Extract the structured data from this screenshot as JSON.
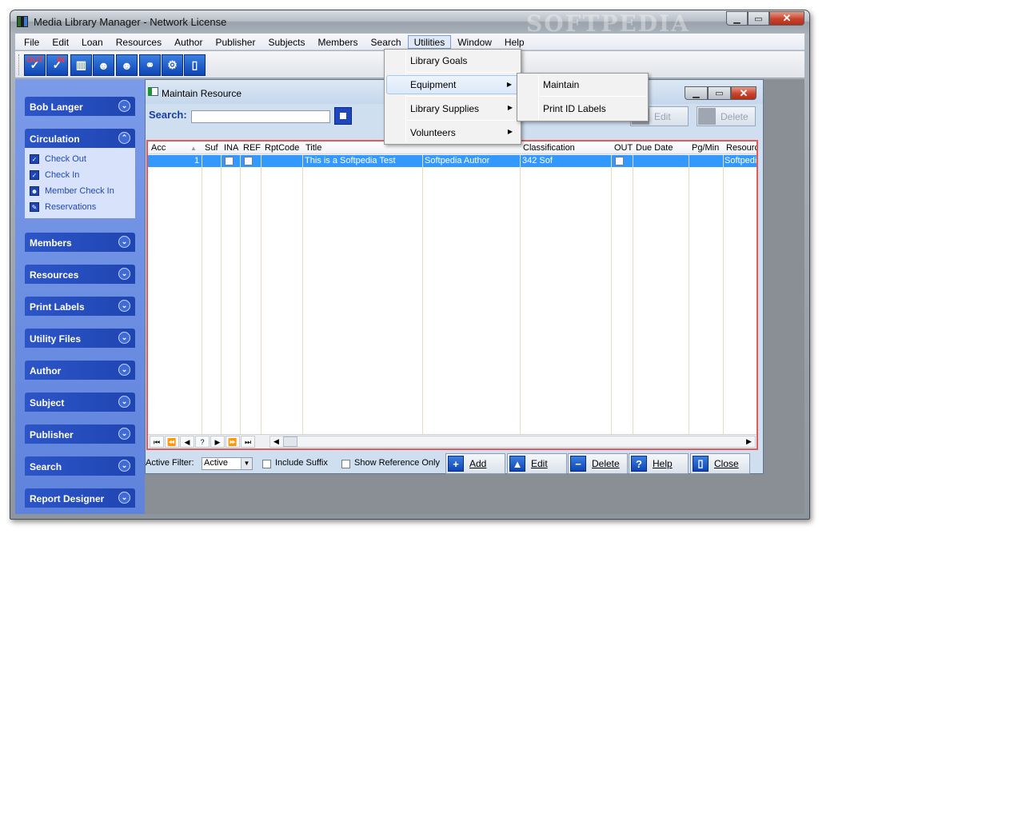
{
  "window": {
    "title": "Media Library Manager - Network License",
    "watermark": "SOFTPEDIA"
  },
  "menubar": [
    "File",
    "Edit",
    "Loan",
    "Resources",
    "Author",
    "Publisher",
    "Subjects",
    "Members",
    "Search",
    "Utilities",
    "Window",
    "Help"
  ],
  "toolbar": {
    "checkout_tag": "OUT",
    "checkin_tag": "IN"
  },
  "sidebar": {
    "user": "Bob Langer",
    "circulation": {
      "title": "Circulation",
      "items": [
        "Check Out",
        "Check In",
        "Member Check In",
        "Reservations"
      ]
    },
    "groups": [
      "Members",
      "Resources",
      "Print Labels",
      "Utility Files",
      "Author",
      "Subject",
      "Publisher",
      "Search",
      "Report Designer"
    ]
  },
  "child": {
    "title": "Maintain Resource",
    "search_label": "Search:",
    "search_value": "",
    "top_edit": "Edit",
    "top_delete": "Delete",
    "columns": [
      "Acc",
      "Suf",
      "INA",
      "REF",
      "RptCode",
      "Title",
      "",
      "Classification",
      "OUT",
      "Due Date",
      "Pg/Min",
      "Resourc"
    ],
    "row": {
      "acc": "1",
      "title": "This is a Softpedia Test",
      "author": "Softpedia Author",
      "classification": "342 Sof",
      "resource": "Softpedi"
    },
    "filter_label": "Active Filter:",
    "filter_value": "Active",
    "include_suffix": "Include Suffix",
    "show_reference": "Show Reference Only",
    "buttons": {
      "add": "Add",
      "edit": "Edit",
      "delete": "Delete",
      "help": "Help",
      "close": "Close"
    }
  },
  "menus": {
    "utilities": [
      "Library Goals",
      "Equipment",
      "Library Supplies",
      "Volunteers"
    ],
    "equipment": [
      "Maintain",
      "Print ID Labels"
    ]
  }
}
